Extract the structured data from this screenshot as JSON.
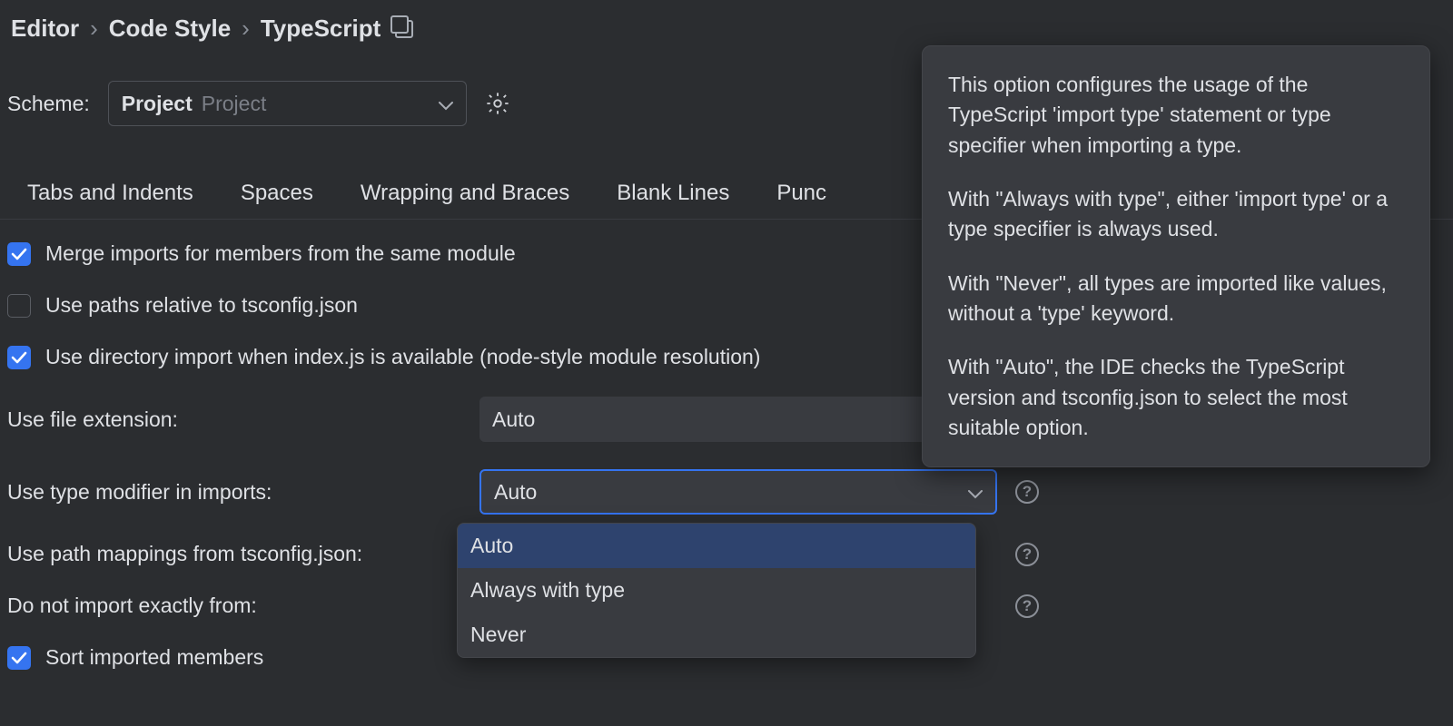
{
  "breadcrumb": [
    "Editor",
    "Code Style",
    "TypeScript"
  ],
  "scheme": {
    "label": "Scheme:",
    "value_bold": "Project",
    "value_dim": "Project"
  },
  "tabs": [
    "Tabs and Indents",
    "Spaces",
    "Wrapping and Braces",
    "Blank Lines",
    "Punc"
  ],
  "checks": {
    "merge_imports": {
      "label": "Merge imports for members from the same module",
      "checked": true
    },
    "relative_paths": {
      "label": "Use paths relative to tsconfig.json",
      "checked": false
    },
    "dir_import": {
      "label": "Use directory import when index.js is available (node-style module resolution)",
      "checked": true
    },
    "sort_members": {
      "label": "Sort imported members",
      "checked": true
    }
  },
  "options": {
    "file_ext": {
      "label": "Use file extension:",
      "value": "Auto"
    },
    "type_modifier": {
      "label": "Use type modifier in imports:",
      "value": "Auto"
    },
    "path_mappings": {
      "label": "Use path mappings from tsconfig.json:"
    },
    "do_not_import": {
      "label": "Do not import exactly from:"
    }
  },
  "dropdown_items": [
    "Auto",
    "Always with type",
    "Never"
  ],
  "tooltip": {
    "p1": "This option configures the usage of the TypeScript 'import type' statement or type specifier when importing a type.",
    "p2": "With \"Always with type\", either 'import type' or a type specifier is always used.",
    "p3": "With \"Never\", all types are imported like values, without a 'type' keyword.",
    "p4": "With \"Auto\", the IDE checks the TypeScript version and tsconfig.json to select the most suitable option."
  }
}
